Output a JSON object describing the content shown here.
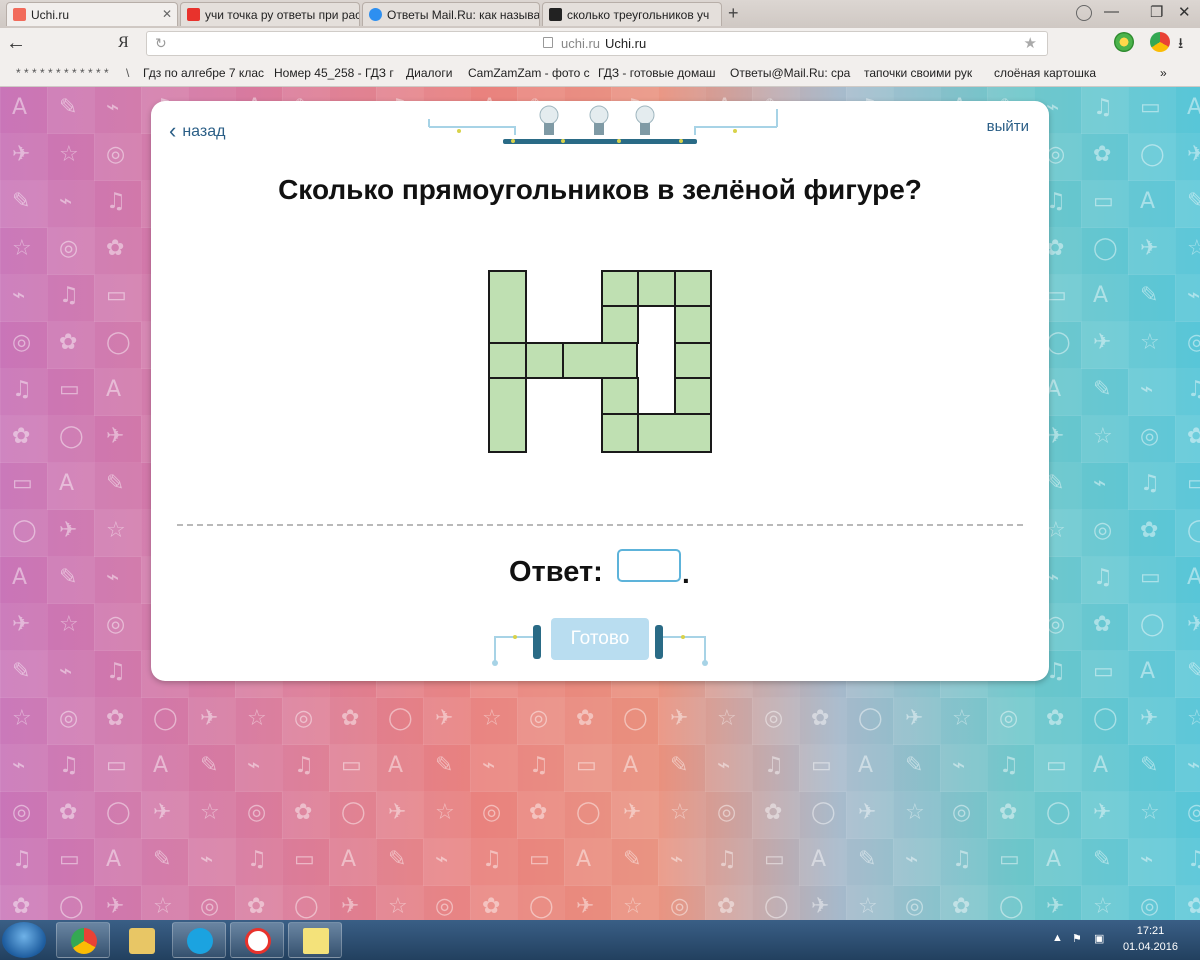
{
  "browser": {
    "tabs": [
      {
        "title": "Uchi.ru",
        "fav_color": "#f26b5b"
      },
      {
        "title": "учи точка ру ответы при рас",
        "fav_color": "#e8322c"
      },
      {
        "title": "Ответы Mail.Ru: как называв",
        "fav_color": "#2d8ff0"
      },
      {
        "title": "сколько треугольников уч",
        "fav_color": "#222222"
      }
    ],
    "new_tab": "+",
    "window_controls": {
      "minimize": "—",
      "restore": "❐",
      "close": "✕"
    },
    "address": {
      "host": "uchi.ru",
      "title": "Uchi.ru"
    },
    "yandex_label": "Я",
    "bookmarks": [
      "* * * * * * * * * * * *",
      "\\",
      "Гдз по алгебре 7 клас",
      "Номер 45_258 - ГДЗ г",
      "Диалоги",
      "CamZamZam - фото с",
      "ГДЗ - готовые домаш",
      "Ответы@Mail.Ru: сра",
      "тапочки своими рук",
      "слоёная картошка",
      "»"
    ]
  },
  "card": {
    "back": "назад",
    "exit": "выйти",
    "question": "Сколько прямоугольников в зелёной фигуре?",
    "answer_label": "Ответ:",
    "answer_value": "",
    "answer_dot": ".",
    "ready_button": "Готово"
  },
  "colors": {
    "figure_fill": "#bfe0b2",
    "figure_stroke": "#1a1a1a",
    "link": "#2b5f87",
    "answer_border": "#5db3da",
    "ready_disabled": "#b9ddf0"
  },
  "taskbar": {
    "apps": [
      "chrome-icon",
      "explorer-icon",
      "skype-icon",
      "yandex-browser-icon",
      "notes-icon"
    ],
    "time": "17:21",
    "date": "01.04.2016"
  }
}
